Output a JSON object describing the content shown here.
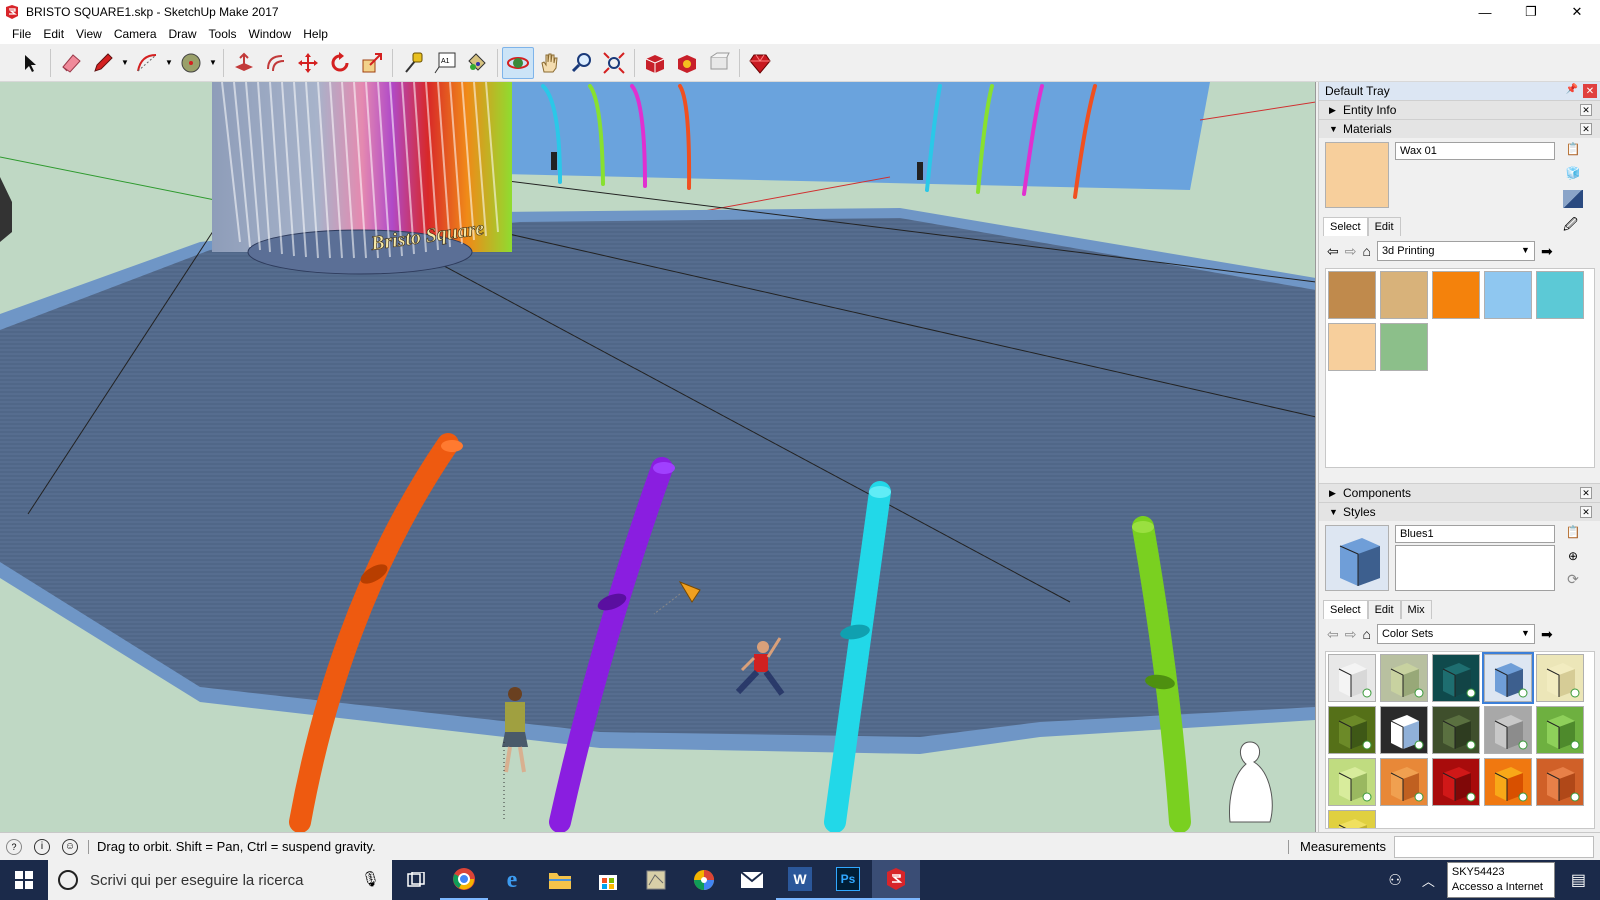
{
  "window": {
    "title": "BRISTO SQUARE1.skp - SketchUp Make 2017",
    "minimize": "—",
    "maximize": "❐",
    "close": "✕"
  },
  "menu": [
    "File",
    "Edit",
    "View",
    "Camera",
    "Draw",
    "Tools",
    "Window",
    "Help"
  ],
  "toolbar": {
    "tools": [
      "select-tool",
      "eraser-tool",
      "line-tool",
      "arc-tool",
      "circle-tool",
      "push-pull-tool",
      "offset-tool",
      "move-tool",
      "rotate-tool",
      "scale-tool",
      "tape-measure-tool",
      "text-tool",
      "paint-bucket-tool",
      "orbit-tool",
      "pan-tool",
      "zoom-tool",
      "zoom-extents-tool",
      "3d-warehouse-tool",
      "extension-warehouse-tool",
      "layout-tool",
      "ruby-tool"
    ],
    "active_tool": "orbit-tool",
    "text_tool_glyph": "A1"
  },
  "viewport": {
    "sign_text": "Bristo Square"
  },
  "tray": {
    "title": "Default Tray",
    "pin_icon": "pin-icon",
    "close": "✕",
    "entity_info": {
      "label": "Entity Info",
      "expanded": false
    },
    "materials": {
      "label": "Materials",
      "expanded": true,
      "current_name": "Wax 01",
      "current_color": "#f7cf9c",
      "tabs": [
        "Select",
        "Edit"
      ],
      "library": "3d Printing",
      "swatches": [
        "#c08a4c",
        "#d8b27a",
        "#f4820c",
        "#8fc7f0",
        "#5cc9d6",
        "#f7cf9c",
        "#8cbf8a"
      ]
    },
    "components": {
      "label": "Components",
      "expanded": false
    },
    "styles": {
      "label": "Styles",
      "expanded": true,
      "current_name": "Blues1",
      "description": "",
      "tabs": [
        "Select",
        "Edit",
        "Mix"
      ],
      "library": "Color Sets",
      "swatches": [
        {
          "face": "#f4f4f4",
          "side": "#d8d8d8",
          "bg": "#e8e8e8"
        },
        {
          "face": "#c8d2a0",
          "side": "#98a878",
          "bg": "#b8c0a0"
        },
        {
          "face": "#1e6e70",
          "side": "#124446",
          "bg": "#0f4a4c"
        },
        {
          "face": "#6f9ed8",
          "side": "#3d5f8e",
          "bg": "#dde6f2"
        },
        {
          "face": "#f2ecc0",
          "side": "#d6cc96",
          "bg": "#ece6b8"
        },
        {
          "face": "#6c8a28",
          "side": "#3e5816",
          "bg": "#557018"
        },
        {
          "face": "#ffffff",
          "side": "#90b0d8",
          "bg": "#2a2a2a"
        },
        {
          "face": "#5a7040",
          "side": "#2e3c20",
          "bg": "#3f4f2c"
        },
        {
          "face": "#c8c8c8",
          "side": "#8c8c8c",
          "bg": "#a8a8a8"
        },
        {
          "face": "#8ed05a",
          "side": "#4e8a2c",
          "bg": "#6eb040"
        },
        {
          "face": "#d8ec9c",
          "side": "#9ab860",
          "bg": "#c0dc80"
        },
        {
          "face": "#f0a050",
          "side": "#c06020",
          "bg": "#e88838"
        },
        {
          "face": "#d01818",
          "side": "#800808",
          "bg": "#a80c0c"
        },
        {
          "face": "#f8a818",
          "side": "#d85000",
          "bg": "#f07810"
        },
        {
          "face": "#e88048",
          "side": "#b04818",
          "bg": "#d06028"
        },
        {
          "face": "#f0e060",
          "side": "#c0b030",
          "bg": "#e0d040"
        }
      ],
      "selected_index": 3
    }
  },
  "status": {
    "message": "Drag to orbit. Shift = Pan, Ctrl = suspend gravity.",
    "measurements_label": "Measurements",
    "measurements_value": ""
  },
  "taskbar": {
    "search_placeholder": "Scrivi qui per eseguire la ricerca",
    "network_name": "SKY54423",
    "network_status": "Accesso a Internet"
  }
}
